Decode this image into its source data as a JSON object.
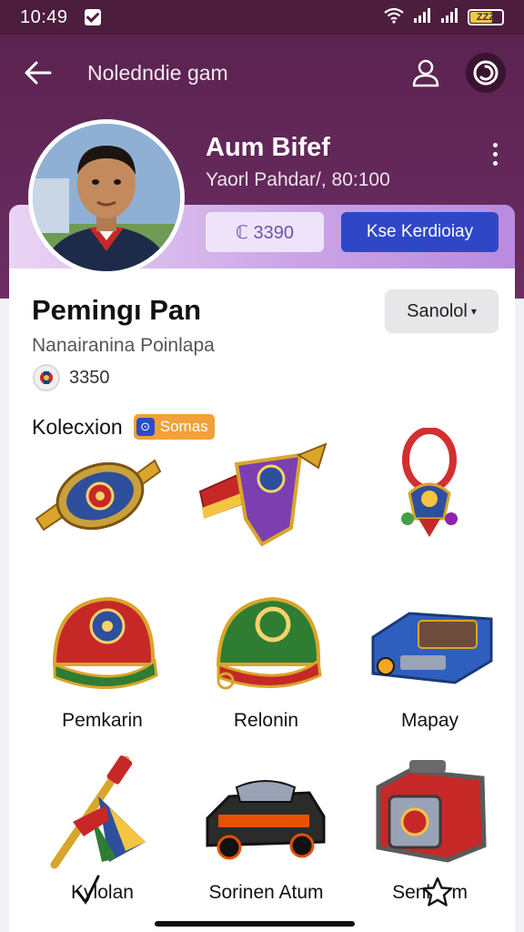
{
  "status": {
    "time": "10:49",
    "battery_label": "ZZZ",
    "battery_level": 0.7
  },
  "topbar": {
    "title": "Noledndie gam",
    "back_icon": "arrow-left-icon",
    "user_icon": "user-icon",
    "settings_icon": "settings-icon"
  },
  "profile": {
    "name": "Aum Bifef",
    "subtitle": "Yaorl Pahdar/, 80:100"
  },
  "actions": {
    "coins": "ℂ 3390",
    "primary": "Kse Kerdioiay"
  },
  "section": {
    "title": "Pemingı Pan",
    "subtitle": "Nanairanina Poinlapa",
    "sort_label": "Sanolol",
    "score": "3350"
  },
  "collection": {
    "label": "Kolecxion",
    "badge": "Somas"
  },
  "items": [
    {
      "label": ""
    },
    {
      "label": ""
    },
    {
      "label": ""
    },
    {
      "label": "Pemkarin"
    },
    {
      "label": "Relonin"
    },
    {
      "label": "Mapay"
    },
    {
      "label": "Kylolan"
    },
    {
      "label": "Sorinen Atum"
    },
    {
      "label": "Senkn m"
    }
  ],
  "colors": {
    "header": "#5b2350",
    "primary_button": "#2f47c7",
    "badge": "#f2a03a"
  }
}
